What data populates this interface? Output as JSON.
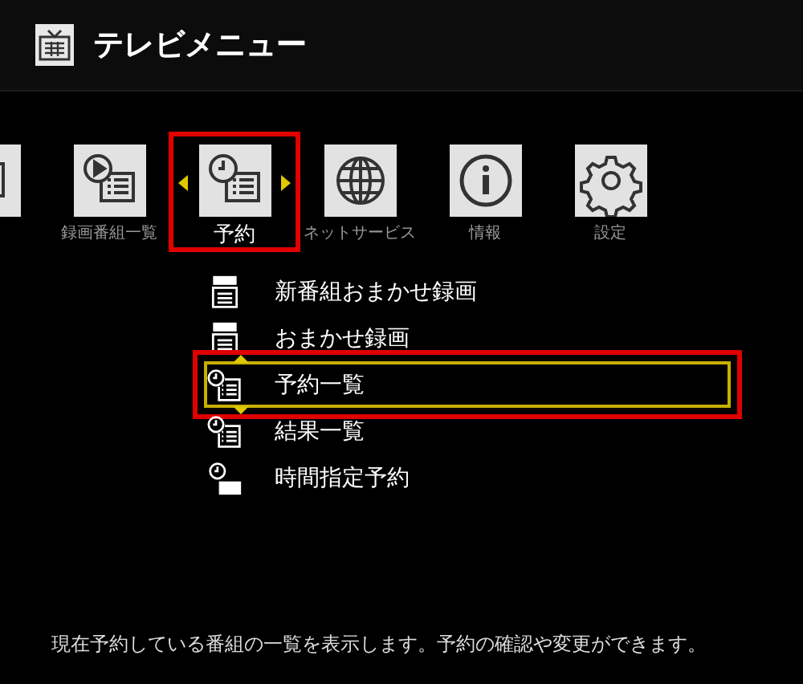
{
  "header": {
    "title": "テレビメニュー"
  },
  "menu": [
    {
      "kind": "list",
      "selected": false
    },
    {
      "label": "録画番組一覧",
      "kind": "play-list",
      "selected": false
    },
    {
      "label": "予約",
      "kind": "clock-list",
      "selected": true
    },
    {
      "label": "ネットサービス",
      "kind": "globe",
      "selected": false
    },
    {
      "label": "情報",
      "kind": "info",
      "selected": false
    },
    {
      "label": "設定",
      "kind": "gear",
      "selected": false
    }
  ],
  "submenu": [
    {
      "label": "新番組おまかせ録画",
      "kind": "tagged-list",
      "selected": false
    },
    {
      "label": "おまかせ録画",
      "kind": "tagged-list",
      "selected": false
    },
    {
      "label": "予約一覧",
      "kind": "clock-list",
      "selected": true
    },
    {
      "label": "結果一覧",
      "kind": "clock-list",
      "selected": false
    },
    {
      "label": "時間指定予約",
      "kind": "clock-tag",
      "selected": false
    }
  ],
  "footer": {
    "text": "現在予約している番組の一覧を表示します。予約の確認や変更ができます。"
  }
}
